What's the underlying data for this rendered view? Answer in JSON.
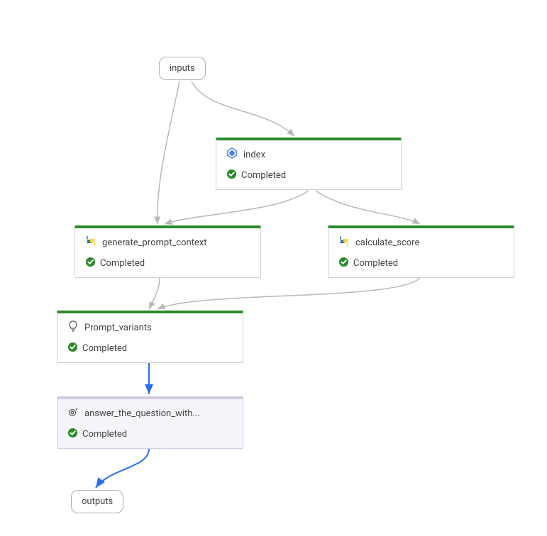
{
  "nodes": {
    "inputs": {
      "label": "inputs"
    },
    "index": {
      "label": "index",
      "status": "Completed",
      "iconType": "hex-blue"
    },
    "generate_prompt_context": {
      "label": "generate_prompt_context",
      "status": "Completed",
      "iconType": "python"
    },
    "calculate_score": {
      "label": "calculate_score",
      "status": "Completed",
      "iconType": "python"
    },
    "prompt_variants": {
      "label": " Prompt_variants",
      "status": "Completed",
      "iconType": "lightbulb"
    },
    "answer_the_question": {
      "label": "answer_the_question_with...",
      "status": "Completed",
      "iconType": "gear-sparkle"
    },
    "outputs": {
      "label": "outputs"
    }
  },
  "statusColor": "#2a8a2a",
  "edgeGrayColor": "#b8b8b8",
  "edgeBlueColor": "#2b6cf0"
}
